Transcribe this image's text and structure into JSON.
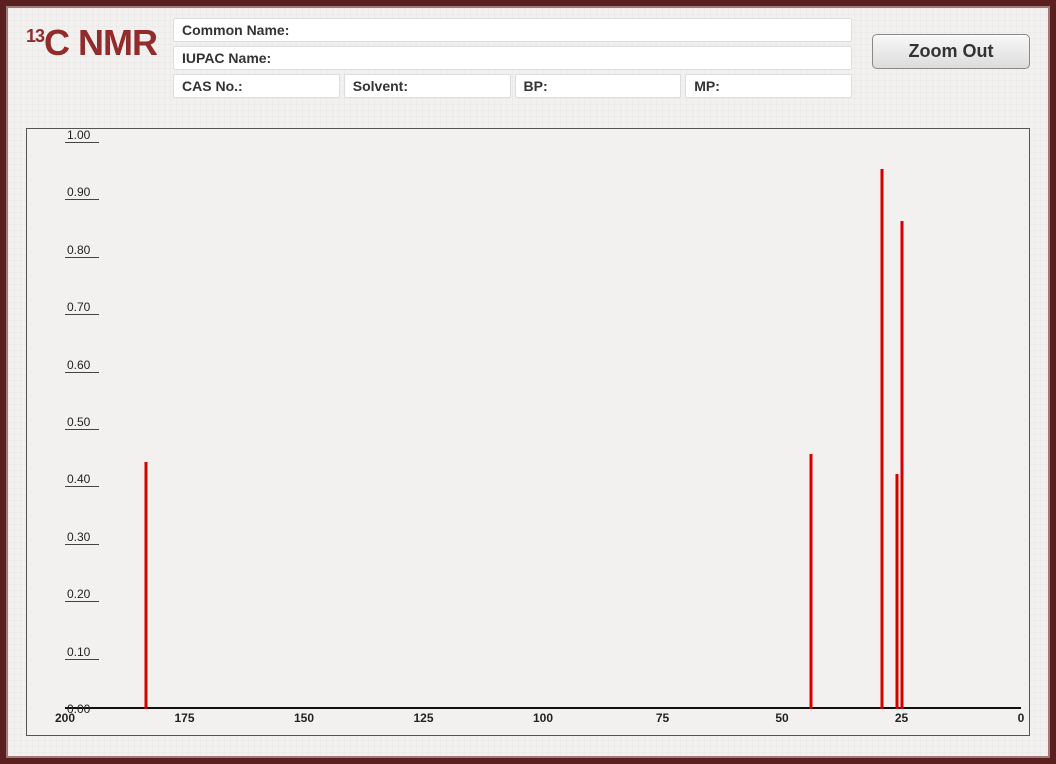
{
  "logo_prefix": "13",
  "logo_text": "C NMR",
  "fields": {
    "common_name_label": "Common Name:",
    "common_name_value": "",
    "iupac_label": "IUPAC Name:",
    "iupac_value": "",
    "cas_label": "CAS No.:",
    "cas_value": "",
    "solvent_label": "Solvent:",
    "solvent_value": "",
    "bp_label": "BP:",
    "bp_value": "",
    "mp_label": "MP:",
    "mp_value": ""
  },
  "zoom_out_label": "Zoom Out",
  "chart_data": {
    "type": "bar",
    "title": "",
    "xlabel": "",
    "ylabel": "",
    "xlim": [
      200,
      0
    ],
    "ylim": [
      0,
      1.0
    ],
    "x_ticks": [
      200,
      175,
      150,
      125,
      100,
      75,
      50,
      25,
      0
    ],
    "y_ticks": [
      0.0,
      0.1,
      0.2,
      0.3,
      0.4,
      0.5,
      0.6,
      0.7,
      0.8,
      0.9,
      1.0
    ],
    "x_tick_labels": [
      "200",
      "175",
      "150",
      "125",
      "100",
      "75",
      "50",
      "25",
      "0"
    ],
    "y_tick_labels": [
      "0.00",
      "0.10",
      "0.20",
      "0.30",
      "0.40",
      "0.50",
      "0.60",
      "0.70",
      "0.80",
      "0.90",
      "1.00"
    ],
    "series": [
      {
        "name": "intensity",
        "points": [
          {
            "x": 183,
            "y": 0.43
          },
          {
            "x": 44,
            "y": 0.445
          },
          {
            "x": 29,
            "y": 0.94
          },
          {
            "x": 26,
            "y": 0.41
          },
          {
            "x": 25,
            "y": 0.85
          }
        ]
      }
    ]
  }
}
